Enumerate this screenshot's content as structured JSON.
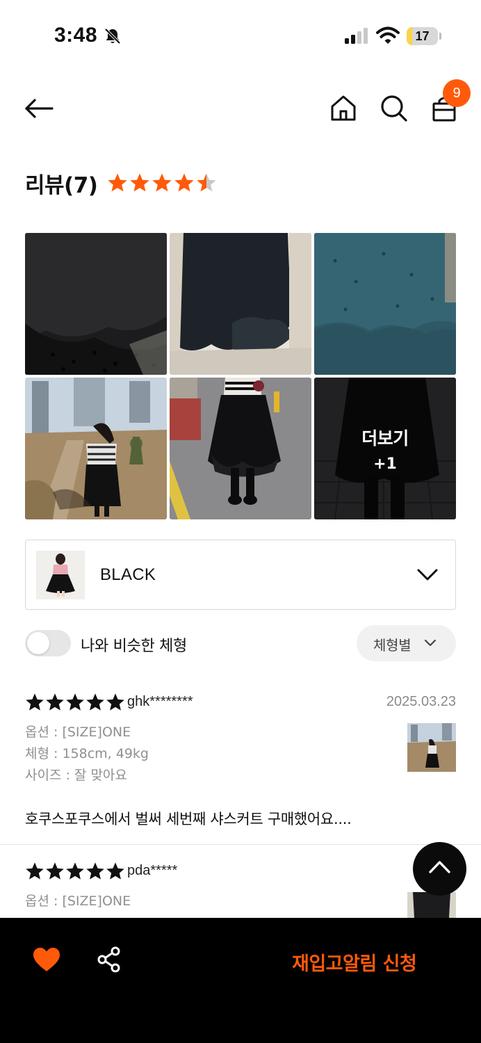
{
  "status_bar": {
    "time": "3:48",
    "battery": "17",
    "battery_fraction": 0.17,
    "icons": [
      "bell-off-icon",
      "signal-icon",
      "wifi-icon",
      "battery-icon"
    ]
  },
  "header": {
    "icons": [
      "back-arrow-icon",
      "home-icon",
      "search-icon",
      "shopping-bag-icon"
    ],
    "cart_count": "9"
  },
  "review_summary": {
    "title": "리뷰(7)",
    "rating": 4.5,
    "star_color": "#FF5A0A"
  },
  "photo_grid": {
    "more_label": "더보기",
    "more_count": "+1",
    "photo_count": 6
  },
  "option_select": {
    "value": "BLACK",
    "icon": "chevron-down-icon"
  },
  "filters": {
    "similar_body_toggle_label": "나와 비슷한 체형",
    "similar_body_toggle_on": false,
    "body_type_label": "체형별"
  },
  "reviews": [
    {
      "rating": 5,
      "user": "ghk********",
      "date": "2025.03.23",
      "option": "옵션 : [SIZE]ONE",
      "body": "체형 : 158cm, 49kg",
      "size": "사이즈 : 잘 맞아요",
      "text": "호쿠스포쿠스에서 벌써 세번째 샤스커트 구매했어요...."
    },
    {
      "rating": 5,
      "user": "pda*****",
      "date": "2025",
      "option": "옵션 : [SIZE]ONE"
    }
  ],
  "bottom_bar": {
    "restock_label": "재입고알림 신청",
    "accent_color": "#FF5A0A",
    "icons": [
      "heart-icon",
      "share-icon"
    ]
  }
}
